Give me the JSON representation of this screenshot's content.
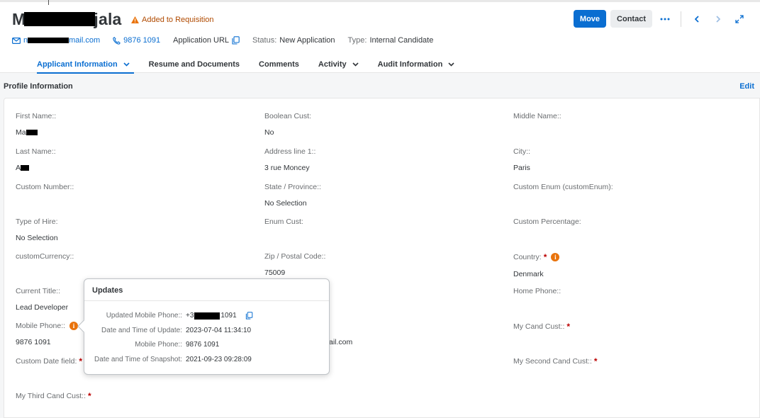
{
  "header": {
    "title_start": "M",
    "title_end": "jala",
    "requisition_badge": "Added to Requisition",
    "actions": {
      "move": "Move",
      "contact": "Contact"
    },
    "contact_info": {
      "email_start": "n",
      "email_end": "mail.com",
      "phone": "9876 1091",
      "application_url": "Application URL",
      "status_label": "Status:",
      "status_value": "New Application",
      "type_label": "Type:",
      "type_value": "Internal Candidate"
    },
    "tabs": [
      {
        "label": "Applicant Information",
        "active": true,
        "has_dropdown": true
      },
      {
        "label": "Resume and Documents",
        "active": false,
        "has_dropdown": false
      },
      {
        "label": "Comments",
        "active": false,
        "has_dropdown": false
      },
      {
        "label": "Activity",
        "active": false,
        "has_dropdown": true
      },
      {
        "label": "Audit Information",
        "active": false,
        "has_dropdown": true
      }
    ]
  },
  "section": {
    "title": "Profile Information",
    "edit": "Edit"
  },
  "fields": {
    "first_name": {
      "label": "First Name::",
      "value": "Ma"
    },
    "boolean_cust": {
      "label": "Boolean Cust:",
      "value": "No"
    },
    "middle_name": {
      "label": "Middle Name::",
      "value": ""
    },
    "last_name": {
      "label": "Last Name::",
      "value": "A"
    },
    "address_line_1": {
      "label": "Address line 1::",
      "value": "3 rue Moncey"
    },
    "city": {
      "label": "City::",
      "value": "Paris"
    },
    "custom_number": {
      "label": "Custom Number::",
      "value": ""
    },
    "state_province": {
      "label": "State / Province::",
      "value": "No Selection"
    },
    "custom_enum": {
      "label": "Custom Enum (customEnum):",
      "value": ""
    },
    "type_of_hire": {
      "label": "Type of Hire:",
      "value": "No Selection"
    },
    "enum_cust": {
      "label": "Enum Cust:",
      "value": ""
    },
    "custom_percentage": {
      "label": "Custom Percentage:",
      "value": ""
    },
    "custom_currency": {
      "label": "customCurrency::",
      "value": ""
    },
    "zip_postal_code": {
      "label": "Zip / Postal Code::",
      "value": "75009"
    },
    "country": {
      "label": "Country:",
      "value": "Denmark"
    },
    "current_title": {
      "label": "Current Title::",
      "value": "Lead Developer"
    },
    "home_phone": {
      "label": "Home Phone::",
      "value": ""
    },
    "mobile_phone": {
      "label": "Mobile Phone::",
      "value": "9876 1091"
    },
    "email_partial": {
      "value": "ail.com"
    },
    "my_cand_cust": {
      "label": "My Cand Cust::",
      "value": ""
    },
    "custom_date_field": {
      "label": "Custom Date field:",
      "value": ""
    },
    "my_second_cand_cust": {
      "label": "My Second Cand Cust::",
      "value": ""
    },
    "my_third_cand_cust": {
      "label": "My Third Cand Cust::",
      "value": ""
    }
  },
  "required_marker": "*",
  "info_marker": "i",
  "popover": {
    "title": "Updates",
    "rows": [
      {
        "key": "Updated Mobile Phone::",
        "value_start": "+3",
        "value_end": "1091"
      },
      {
        "key": "Date and Time of Update:",
        "value": "2023-07-04 11:34:10"
      },
      {
        "key": "Mobile Phone::",
        "value": "9876 1091"
      },
      {
        "key": "Date and Time of Snapshot:",
        "value": "2021-09-23 09:28:09"
      }
    ]
  },
  "icons": {
    "warning": "warning-triangle-icon",
    "mail": "mail-icon",
    "phone": "phone-icon",
    "copy": "copy-icon",
    "more": "overflow-icon",
    "prev": "chevron-left-icon",
    "next": "chevron-right-icon",
    "fullscreen": "fullscreen-icon",
    "dropdown": "chevron-down-icon",
    "info": "info-icon"
  },
  "colors": {
    "accent": "#0a6ed1",
    "warning": "#e9730c",
    "required": "#bb0000",
    "badge_text": "#b04a00"
  }
}
